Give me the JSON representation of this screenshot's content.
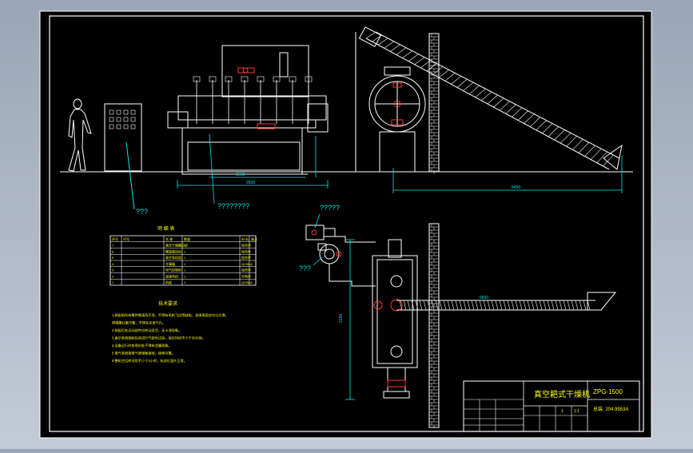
{
  "labels": {
    "control_cabinet": "???",
    "machine_callout": "????????",
    "motor_callout": "?????",
    "hopper_callout": "???"
  },
  "dims": {
    "machine_width": "2630",
    "frame_width": "1550",
    "conveyor_length": "5430",
    "tank_height": "3130",
    "overall_length": "6830"
  },
  "parts_table": {
    "title": "明 细 表",
    "headers": [
      "序号",
      "代号",
      "名 称",
      "数量",
      "材 料",
      "备注"
    ],
    "rows": [
      [
        "7",
        "",
        "真空干燥罐总成",
        "1",
        "组合件",
        ""
      ],
      [
        "6",
        "",
        "螺旋输送机",
        "1",
        "组合件",
        ""
      ],
      [
        "5",
        "",
        "真空泵机组",
        "1",
        "组合件",
        ""
      ],
      [
        "4",
        "",
        "冷凝器",
        "1",
        "Q235-A",
        ""
      ],
      [
        "3",
        "",
        "电气控制柜",
        "1",
        "组合件",
        ""
      ],
      [
        "2",
        "",
        "减速电机",
        "1",
        "外购件",
        ""
      ],
      [
        "1",
        "",
        "机架",
        "1",
        "Q235-A",
        ""
      ]
    ]
  },
  "notes": {
    "title": "技术要求",
    "lines": [
      "1.装配前所有零件需清洗干净，不得有毛刺飞边等缺陷，油漆表面应均匀光滑。",
      "  焊缝需打磨平整，不得有夹渣气孔。",
      "2.装配后各运动部件应转动灵活，无卡滞现象。",
      "3.真空系统装配后须进行气密性试验，保压时间不少于30分钟。",
      "4.设备运行时各密封处不得有泄漏现象。",
      "5.电气系统按电气原理图接线，接地可靠。",
      "6.整机空运转试验不少于2小时，各部位温升正常。"
    ]
  },
  "title_block": {
    "title": "真空耙式干燥机",
    "code": "ZPG-1500",
    "subtitle": "总装, 204.9953A",
    "scale": "1:1",
    "sheet": "1"
  },
  "colors": {
    "background": "#000000",
    "frame": "#ffffff",
    "machine": "#ffffff",
    "callout": "#00e6e6",
    "text_yellow": "#ffff00",
    "red_parts": "#ff3333",
    "brick": "#ffffff"
  }
}
